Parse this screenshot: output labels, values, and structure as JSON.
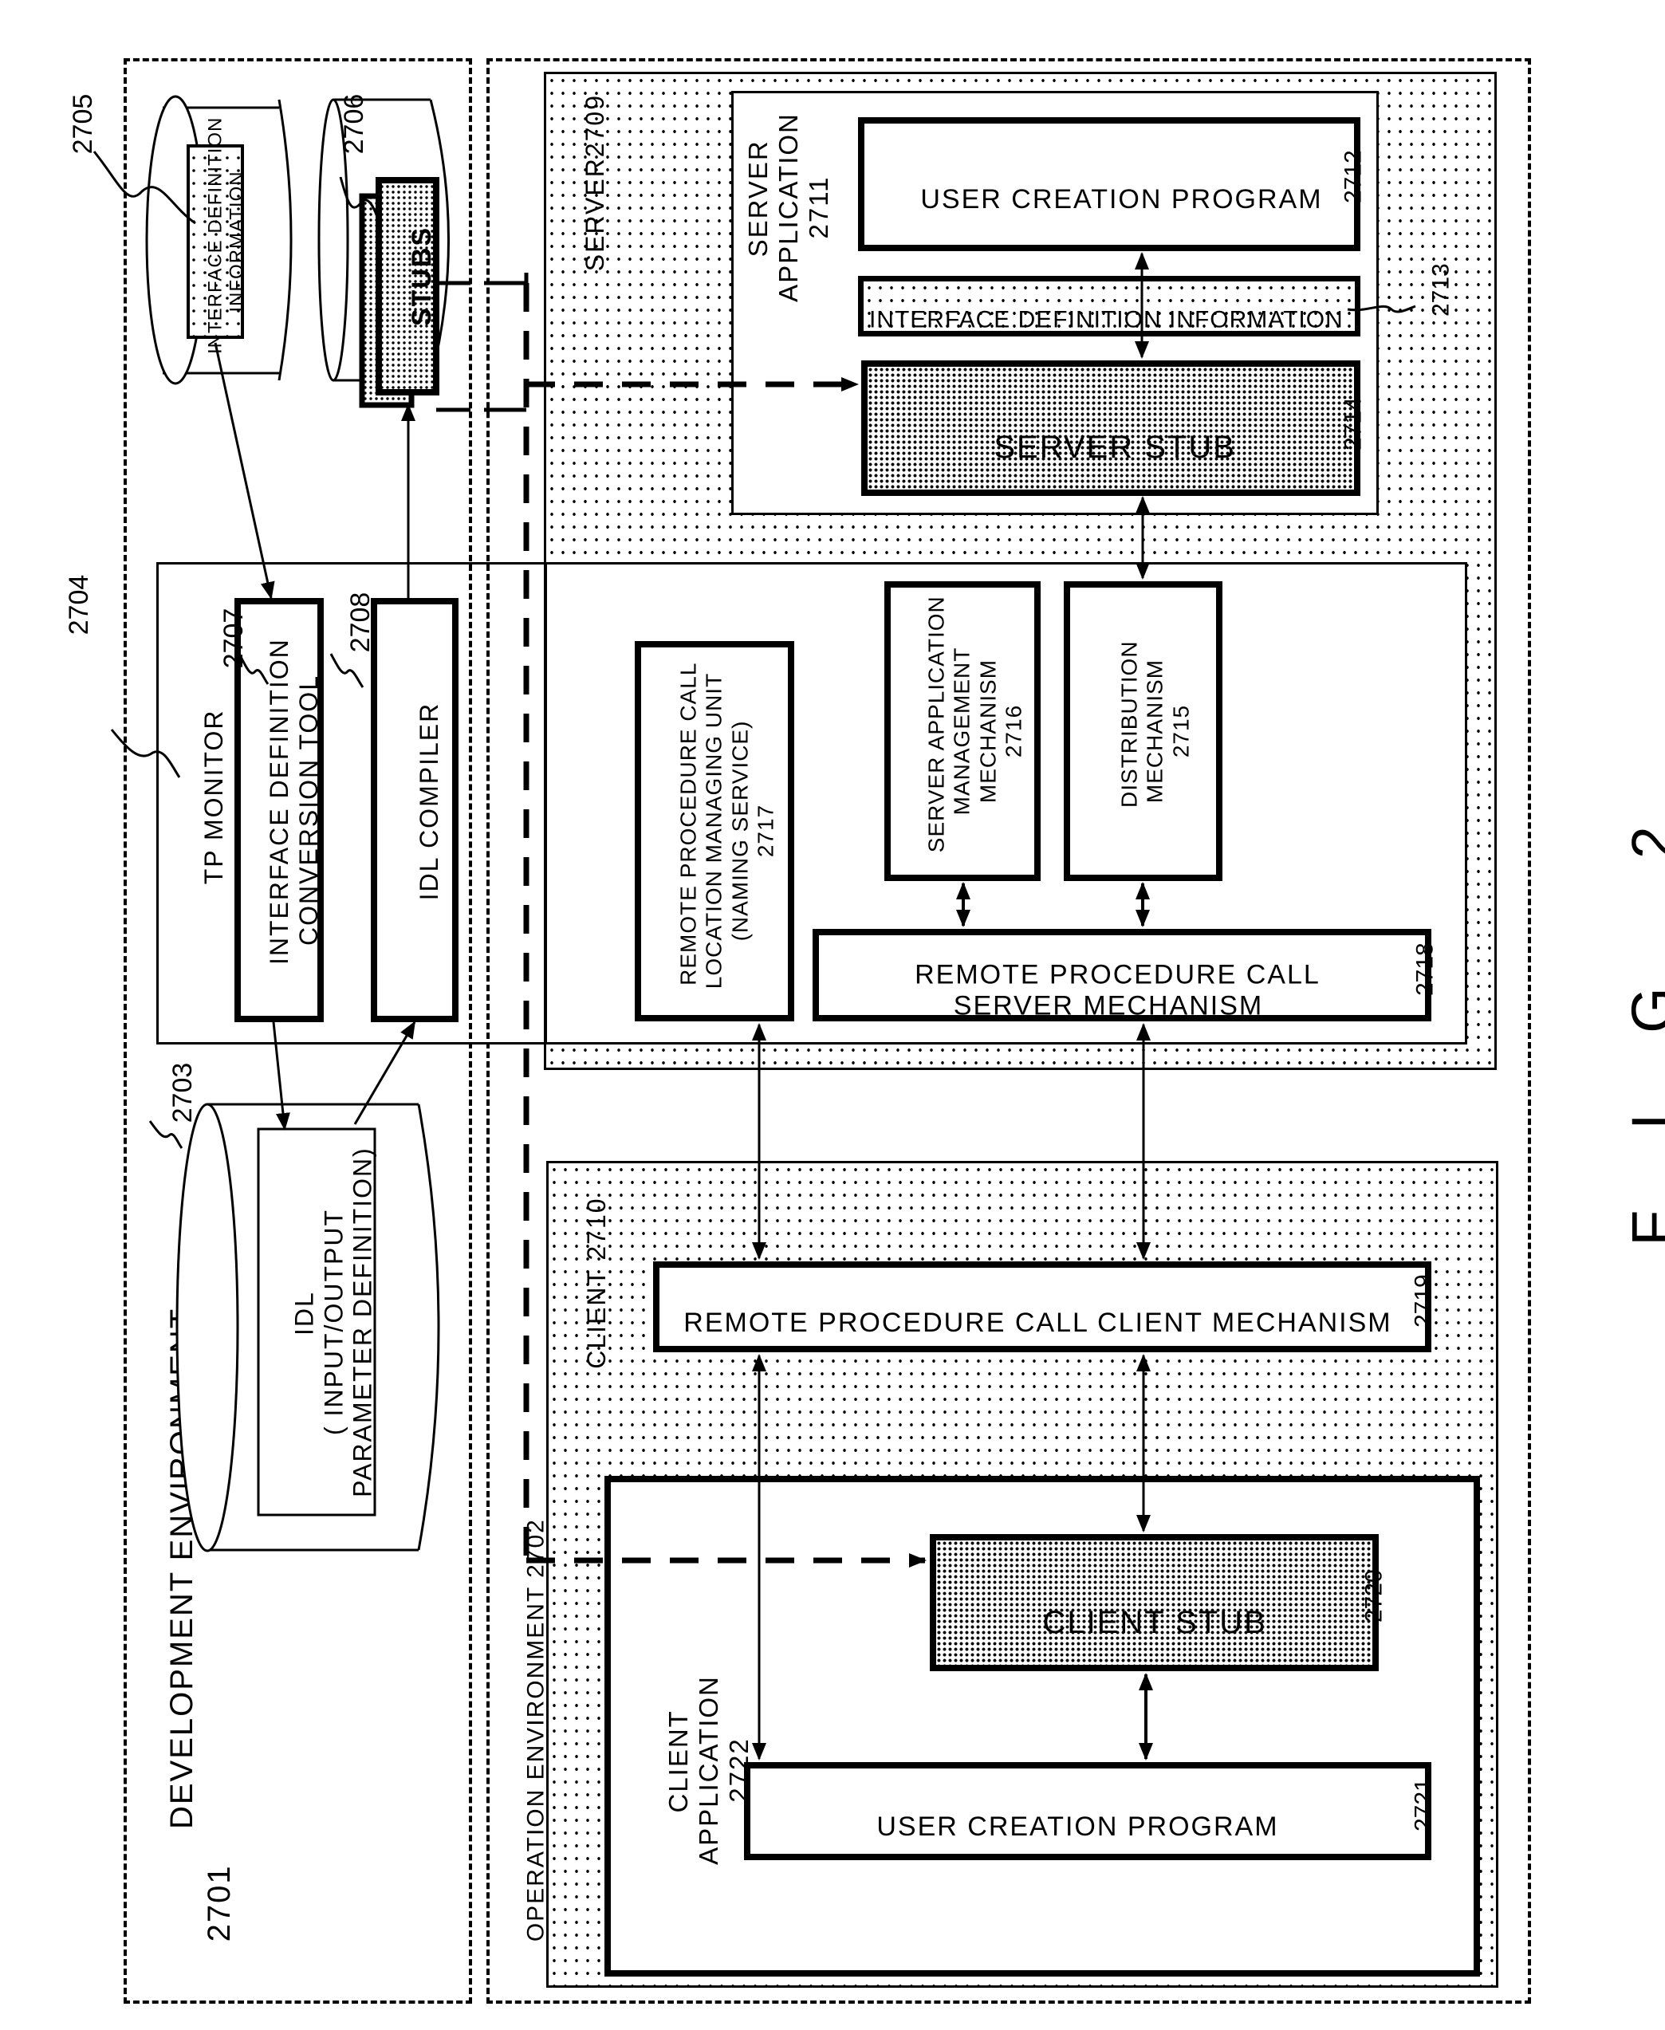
{
  "figure": {
    "label": "F I G. 2"
  },
  "development_environment": {
    "title": "DEVELOPMENT ENVIRONMENT",
    "ref": "2701",
    "idl_store": {
      "ref": "2703",
      "content": "IDL\n( INPUT/OUTPUT\nPARAMETER DEFINITION)"
    },
    "tp_monitor": {
      "ref": "2704",
      "title": "TP MONITOR",
      "conversion_tool": {
        "ref": "2707",
        "label": "INTERFACE DEFINITION\nCONVERSION TOOL"
      },
      "idl_compiler": {
        "ref": "2708",
        "label": "IDL COMPILER"
      }
    },
    "interface_definition_store": {
      "ref": "2705",
      "content": "INTERFACE DEFINITION\nINFORMATION"
    },
    "stubs_store": {
      "ref": "2706",
      "content": "STUBS"
    }
  },
  "operation_environment": {
    "title": "OPERATION ENVIRONMENT 2702",
    "server": {
      "title": "SERVER2709",
      "server_application": {
        "label": "SERVER\nAPPLICATION\n2711",
        "user_creation_program": {
          "label": "USER CREATION PROGRAM",
          "ref": "2712"
        },
        "interface_definition_information": {
          "label": "INTERFACE DEFINITION INFORMATION",
          "ref": "2713"
        },
        "server_stub": {
          "label": "SERVER STUB",
          "ref": "2714"
        }
      },
      "naming_service": {
        "label": "REMOTE PROCEDURE CALL\nLOCATION MANAGING UNIT\n(NAMING SERVICE)\n2717"
      },
      "server_app_management": {
        "label": "SERVER APPLICATION\nMANAGEMENT\nMECHANISM\n2716"
      },
      "distribution": {
        "label": "DISTRIBUTION\nMECHANISM\n2715"
      },
      "rpc_server_mechanism": {
        "label": "REMOTE PROCEDURE CALL\nSERVER MECHANISM",
        "ref": "2718"
      }
    },
    "client": {
      "title": "CLIENT 2710",
      "rpc_client_mechanism": {
        "label": "REMOTE PROCEDURE CALL CLIENT MECHANISM",
        "ref": "2719"
      },
      "client_application": {
        "label": "CLIENT\nAPPLICATION\n2722",
        "client_stub": {
          "label": "CLIENT STUB",
          "ref": "2720"
        },
        "user_creation_program": {
          "label": "USER CREATION PROGRAM",
          "ref": "2721"
        }
      }
    }
  }
}
